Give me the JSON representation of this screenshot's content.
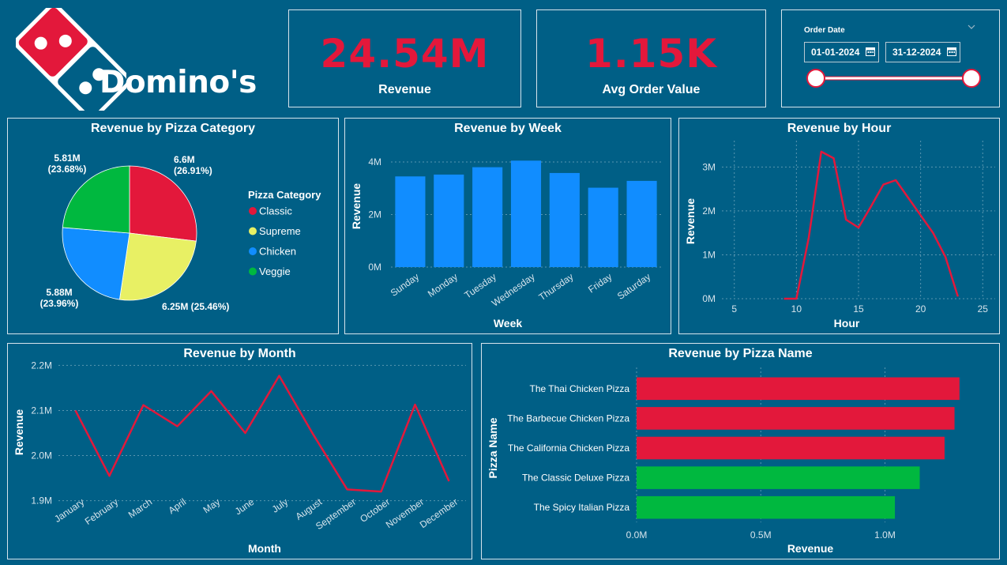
{
  "brand": {
    "name": "Domino's"
  },
  "kpis": [
    {
      "value": "24.54M",
      "label": "Revenue"
    },
    {
      "value": "1.15K",
      "label": "Avg Order Value"
    }
  ],
  "date_filter": {
    "label": "Order Date",
    "start": "01-01-2024",
    "end": "31-12-2024"
  },
  "colors": {
    "background": "#005f86",
    "red": "#e3183b",
    "blue": "#118dff",
    "green": "#00b83f",
    "yellow": "#e8f064",
    "kpi": "#e3183b"
  },
  "chart_data": [
    {
      "type": "pie",
      "title": "Revenue by Pizza Category",
      "legend_title": "Pizza Category",
      "legend_placement": "right",
      "categories": [
        "Classic",
        "Supreme",
        "Chicken",
        "Veggie"
      ],
      "values": [
        6.6,
        6.25,
        5.88,
        5.81
      ],
      "colors": [
        "#e3183b",
        "#e8f064",
        "#118dff",
        "#00b83f"
      ],
      "data_labels": [
        "6.6M (26.91%)",
        "6.25M (25.46%)",
        "5.88M (23.96%)",
        "5.81M (23.68%)"
      ],
      "data_labels_line1": [
        "6.6M",
        "6.25M (25.46%)",
        "5.88M",
        "5.81M"
      ],
      "data_labels_line2": [
        "(26.91%)",
        "",
        "(23.96%)",
        "(23.68%)"
      ]
    },
    {
      "type": "bar",
      "title": "Revenue by Week",
      "xlabel": "Week",
      "ylabel": "Revenue",
      "categories": [
        "Sunday",
        "Monday",
        "Tuesday",
        "Wednesday",
        "Thursday",
        "Friday",
        "Saturday"
      ],
      "values": [
        3.45,
        3.52,
        3.8,
        4.05,
        3.58,
        3.02,
        3.28
      ],
      "ylim": [
        0,
        4.6
      ],
      "yticks": [
        0,
        2,
        4
      ],
      "ytick_labels": [
        "0M",
        "2M",
        "4M"
      ],
      "grid": true
    },
    {
      "type": "line",
      "title": "Revenue by Hour",
      "xlabel": "Hour",
      "ylabel": "Revenue",
      "x": [
        9,
        10,
        11,
        12,
        13,
        14,
        15,
        16,
        17,
        18,
        19,
        20,
        21,
        22,
        23
      ],
      "values": [
        0.0,
        0.0,
        1.4,
        3.35,
        3.2,
        1.8,
        1.62,
        2.1,
        2.6,
        2.7,
        2.3,
        1.9,
        1.5,
        0.95,
        0.05
      ],
      "xlim": [
        4,
        26
      ],
      "ylim": [
        0,
        3.6
      ],
      "xticks": [
        5,
        10,
        15,
        20,
        25
      ],
      "yticks": [
        0,
        1,
        2,
        3
      ],
      "ytick_labels": [
        "0M",
        "1M",
        "2M",
        "3M"
      ],
      "grid": true
    },
    {
      "type": "line",
      "title": "Revenue by Month",
      "xlabel": "Month",
      "ylabel": "Revenue",
      "categories": [
        "January",
        "February",
        "March",
        "April",
        "May",
        "June",
        "July",
        "August",
        "September",
        "October",
        "November",
        "December"
      ],
      "values": [
        2.1,
        1.955,
        2.112,
        2.065,
        2.143,
        2.05,
        2.177,
        2.047,
        1.925,
        1.92,
        2.113,
        1.943
      ],
      "ylim": [
        1.88,
        2.22
      ],
      "yticks": [
        1.9,
        2.0,
        2.1,
        2.2
      ],
      "ytick_labels": [
        "1.9M",
        "2.0M",
        "2.1M",
        "2.2M"
      ],
      "grid": true
    },
    {
      "type": "bar",
      "orientation": "horizontal",
      "title": "Revenue by Pizza Name",
      "xlabel": "Revenue",
      "ylabel": "Pizza Name",
      "categories": [
        "The Thai Chicken Pizza",
        "The Barbecue Chicken Pizza",
        "The California Chicken Pizza",
        "The Classic Deluxe Pizza",
        "The Spicy Italian Pizza"
      ],
      "values": [
        1.3,
        1.28,
        1.24,
        1.14,
        1.04
      ],
      "colors": [
        "#e3183b",
        "#e3183b",
        "#e3183b",
        "#00b83f",
        "#00b83f"
      ],
      "xlim": [
        0,
        1.38
      ],
      "xticks": [
        0,
        0.5,
        1.0
      ],
      "xtick_labels": [
        "0.0M",
        "0.5M",
        "1.0M"
      ],
      "grid": true
    }
  ]
}
